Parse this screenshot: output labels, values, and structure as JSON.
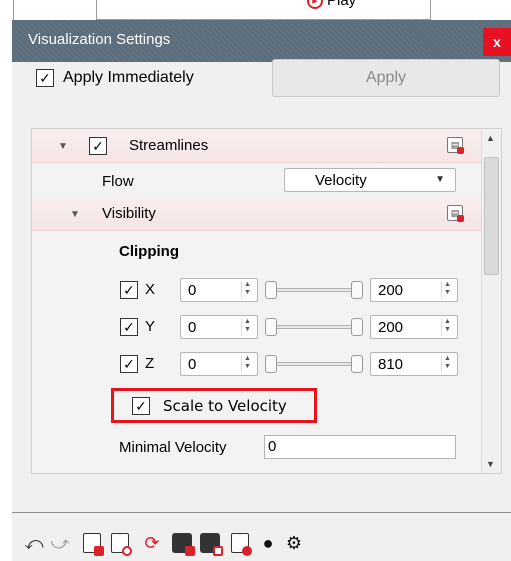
{
  "background": {
    "play_label": "Play"
  },
  "dialog": {
    "title": "Visualization Settings",
    "close_label": "x"
  },
  "topbar": {
    "apply_immediately_label": "Apply Immediately",
    "apply_immediately_checked": true,
    "apply_button_label": "Apply"
  },
  "tree": {
    "streamlines_label": "Streamlines",
    "streamlines_checked": true,
    "flow_label": "Flow",
    "flow_value": "Velocity",
    "visibility_label": "Visibility",
    "clipping_label": "Clipping",
    "clip_rows": [
      {
        "axis": "X",
        "min": "0",
        "max": "200",
        "checked": true
      },
      {
        "axis": "Y",
        "min": "0",
        "max": "200",
        "checked": true
      },
      {
        "axis": "Z",
        "min": "0",
        "max": "810",
        "checked": true
      }
    ],
    "scale_to_velocity_label": "Scale to Velocity",
    "scale_to_velocity_checked": true,
    "minimal_velocity_label": "Minimal Velocity",
    "minimal_velocity_value": "0"
  },
  "toolbar": {
    "icons": [
      "undo-icon",
      "redo-icon",
      "save-doc-icon",
      "load-doc-icon",
      "reload-icon",
      "export-icon",
      "import-icon",
      "script-doc-icon",
      "visibility-icon",
      "settings-gear-icon"
    ]
  },
  "colors": {
    "titlebar": "#5c6d7b",
    "close": "#e81123",
    "highlight": "#e8141c",
    "reset_marker": "#d9222a"
  }
}
